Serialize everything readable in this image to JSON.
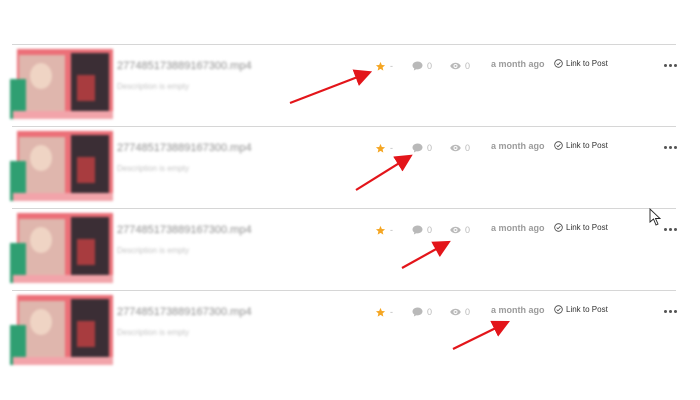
{
  "rows": [
    {
      "title": "277485173889167300.mp4",
      "description": "Description is empty",
      "rating": "-",
      "comments": "0",
      "views": "0",
      "time": "a month ago",
      "link_label": "Link to Post"
    },
    {
      "title": "277485173889167300.mp4",
      "description": "Description is empty",
      "rating": "-",
      "comments": "0",
      "views": "0",
      "time": "a month ago",
      "link_label": "Link to Post"
    },
    {
      "title": "277485173889167300.mp4",
      "description": "Description is empty",
      "rating": "-",
      "comments": "0",
      "views": "0",
      "time": "a month ago",
      "link_label": "Link to Post"
    },
    {
      "title": "277485173889167300.mp4",
      "description": "Description is empty",
      "rating": "-",
      "comments": "0",
      "views": "0",
      "time": "a month ago",
      "link_label": "Link to Post"
    }
  ],
  "icons": {
    "rating": "star-icon",
    "comments": "comment-bubble-icon",
    "views": "eye-icon",
    "link": "check-circle-icon",
    "more": "more-horizontal-icon",
    "cursor": "mouse-pointer-icon",
    "annotation": "red-arrow-annotation"
  },
  "colors": {
    "star": "#f5a623",
    "icon_gray": "#b9b9b9",
    "annotation_arrow": "#e3151a",
    "divider": "#d6d6d6"
  }
}
